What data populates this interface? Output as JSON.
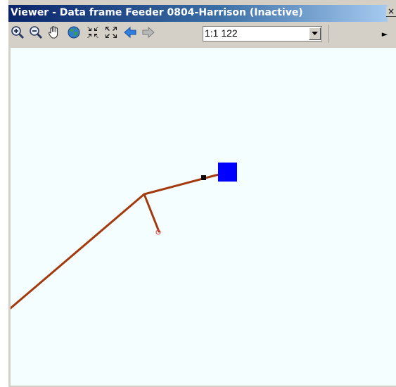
{
  "window": {
    "title": "Viewer - Data frame Feeder 0804-Harrison (Inactive)",
    "close_glyph": "×"
  },
  "toolbar": {
    "tools": [
      {
        "name": "zoom-in-icon"
      },
      {
        "name": "zoom-out-icon"
      },
      {
        "name": "pan-hand-icon"
      },
      {
        "name": "full-extent-globe-icon"
      },
      {
        "name": "fixed-zoom-in-icon"
      },
      {
        "name": "fixed-zoom-out-icon"
      },
      {
        "name": "back-arrow-icon"
      },
      {
        "name": "forward-arrow-icon"
      }
    ],
    "scale": {
      "value": "1:1 122"
    },
    "overflow_glyph": "►"
  },
  "map": {
    "background_color": "#f4feff",
    "line_color": "#a33a0e",
    "source_color": "#0000ff",
    "node_color": "#000000",
    "endpoint_color": "#e05050"
  }
}
